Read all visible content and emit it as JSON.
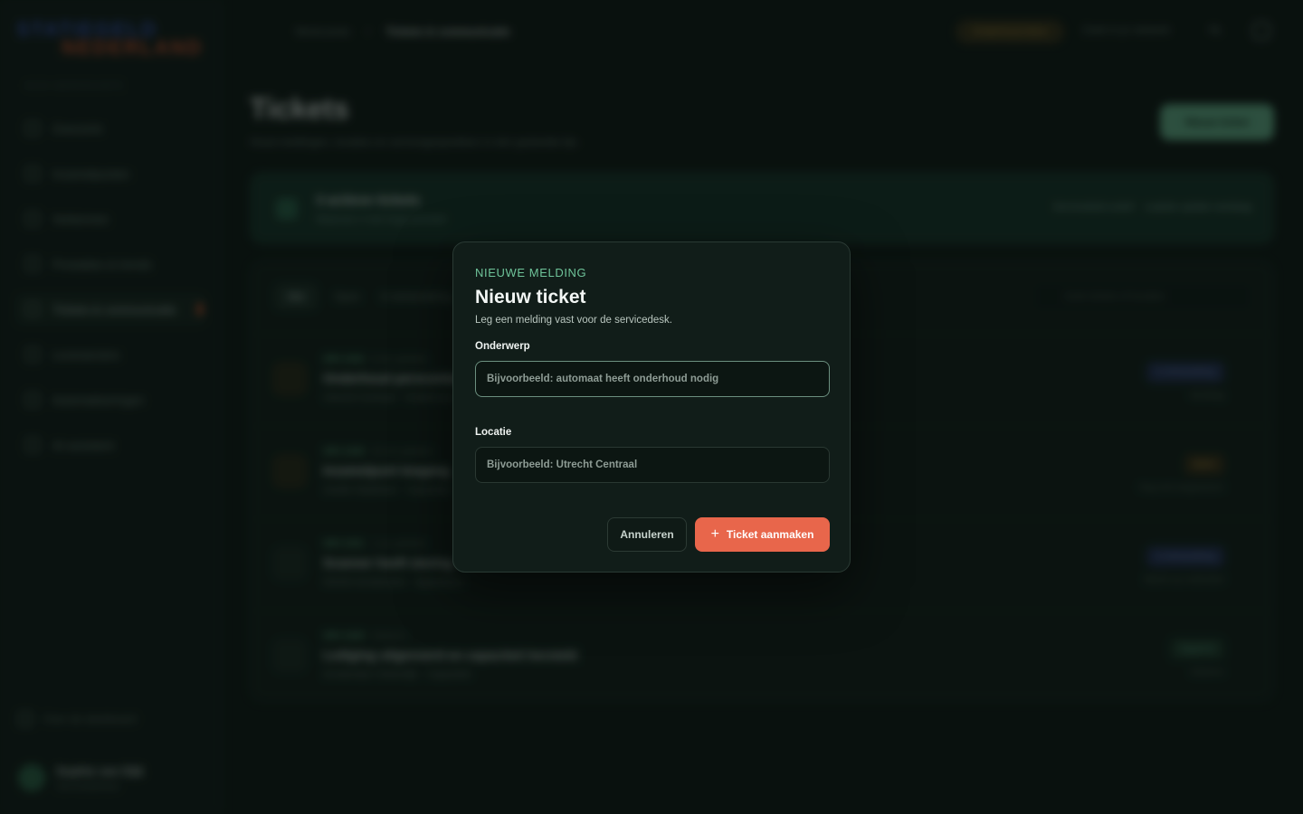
{
  "background": {
    "logo": {
      "line1": "STATIEGELD",
      "line2": "NEDERLAND"
    },
    "sidebar": {
      "section_label": "MIJN WERKRUIMTE",
      "items": [
        {
          "label": "Overzicht"
        },
        {
          "label": "Inzamelpunten"
        },
        {
          "label": "Verkennen"
        },
        {
          "label": "Prestaties & trends"
        },
        {
          "label": "Tickets & communicatie"
        },
        {
          "label": "Leveranciers"
        },
        {
          "label": "Automatiseringen"
        },
        {
          "label": "AI-assistent"
        }
      ],
      "footer_link": "Over de dashboard",
      "user": {
        "name": "Sophie van Dijk",
        "role": "Servicebeheer"
      }
    },
    "topbar": {
      "breadcrumb_root": "Werkruimte",
      "breadcrumb_current": "Tickets & communicatie",
      "status_pill": "Onderhoud deze",
      "search": "Zoek in je netwerk",
      "lang": "NL"
    },
    "header": {
      "title": "Tickets",
      "subtitle": "Houd meldingen, locaties en servicegesprekken in één gedeelde lijn.",
      "new_button": "Nieuw ticket"
    },
    "banner": {
      "title": "3 actieve tickets",
      "subtitle": "Waarvan 2 met hoge prioriteit",
      "status": "Servicedesk actief",
      "updated": "Laatste update vandaag"
    },
    "list": {
      "filters": [
        "Alle",
        "Open",
        "In behandeling"
      ],
      "search_placeholder": "Zoek tickets of locaties",
      "rows": [
        {
          "id": "SRV-1042",
          "time_ago": "8 min geleden",
          "title": "Onderhoud perscontainer",
          "meta": "Utrecht Centraal · Onderhoud",
          "badge": "In behandeling",
          "when": "Vandaag"
        },
        {
          "id": "SRV-1039",
          "time_ago": "32 min geleden",
          "title": "Inzamelpunt toegang",
          "meta": "Zwolle Stadshart · Capaciteit",
          "badge": "Open",
          "when": "Nog niet toegewezen"
        },
        {
          "id": "SRV-1031",
          "time_ago": "1 uur geleden",
          "title": "Scanner heeft storing",
          "meta": "NS/AH Amsterdam · Apparatuur",
          "badge": "In behandeling",
          "when": "Wacht op onderdeel"
        },
        {
          "id": "SRV-1028",
          "time_ago": "Gisteren",
          "title": "Lediging uitgevoerd en capaciteit hersteld",
          "meta": "Amsterdam Sloterdijk · Capaciteit",
          "badge": "Opgelost",
          "when": "Gisteren"
        }
      ]
    }
  },
  "modal": {
    "eyebrow": "NIEUWE MELDING",
    "title": "Nieuw ticket",
    "subtitle": "Leg een melding vast voor de servicedesk.",
    "subject": {
      "label": "Onderwerp",
      "value": "",
      "placeholder": "Bijvoorbeeld: automaat heeft onderhoud nodig"
    },
    "location": {
      "label": "Locatie",
      "value": "",
      "placeholder": "Bijvoorbeeld: Utrecht Centraal"
    },
    "cancel_label": "Annuleren",
    "submit_icon": "plus-icon",
    "submit_label": "Ticket aanmaken"
  },
  "colors": {
    "accent_green": "#6fc49a",
    "primary_button": "#e8664b",
    "modal_bg": "#111d19",
    "page_bg": "#0c1612"
  }
}
